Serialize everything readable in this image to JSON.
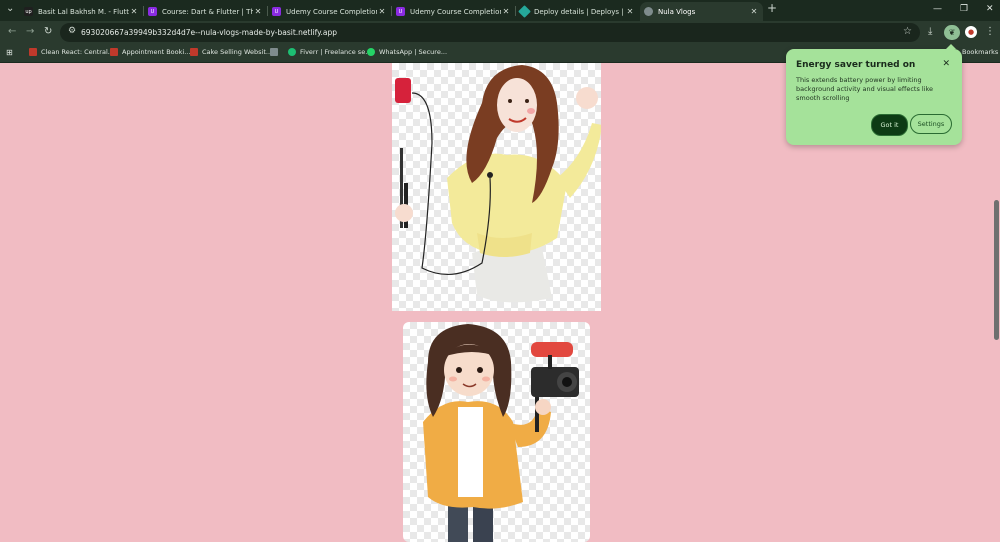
{
  "tabs": [
    {
      "title": "Basit Lal Bakhsh M. - Flutter de",
      "icon": "upwork-icon",
      "color": "#1f1f1f"
    },
    {
      "title": "Course: Dart & Flutter | The Co",
      "icon": "udemy-icon",
      "color": "#8a2be2"
    },
    {
      "title": "Udemy Course Completion Cer",
      "icon": "udemy-icon",
      "color": "#8a2be2"
    },
    {
      "title": "Udemy Course Completion Cer",
      "icon": "udemy-icon",
      "color": "#8a2be2"
    },
    {
      "title": "Deploy details | Deploys | nula-",
      "icon": "netlify-icon",
      "color": "#25a89a"
    },
    {
      "title": "Nula Vlogs",
      "icon": "globe-icon",
      "color": "#7f8c8d"
    }
  ],
  "address": {
    "url": "693020667a39949b332d4d7e--nula-vlogs-made-by-basit.netlify.app"
  },
  "bookmarks": {
    "items": [
      {
        "label": "Clean React: Central...",
        "color": "#c0392b"
      },
      {
        "label": "Appointment Booki...",
        "color": "#c0392b"
      },
      {
        "label": "Cake Selling Websit...",
        "color": "#c0392b"
      },
      {
        "label": "",
        "color": "#7f8c8d"
      },
      {
        "label": "Fiverr | Freelance se...",
        "color": "#1dbf73"
      },
      {
        "label": "WhatsApp | Secure...",
        "color": "#25d366"
      }
    ],
    "all_label": "Bookmarks"
  },
  "popup": {
    "title": "Energy saver turned on",
    "body": "This extends battery power by limiting background activity and visual effects like smooth scrolling",
    "primary": "Got it",
    "secondary": "Settings"
  },
  "colors": {
    "page_background": "#f1bcc3",
    "chrome": "#2a3a2e",
    "popup": "#a5e29a"
  }
}
